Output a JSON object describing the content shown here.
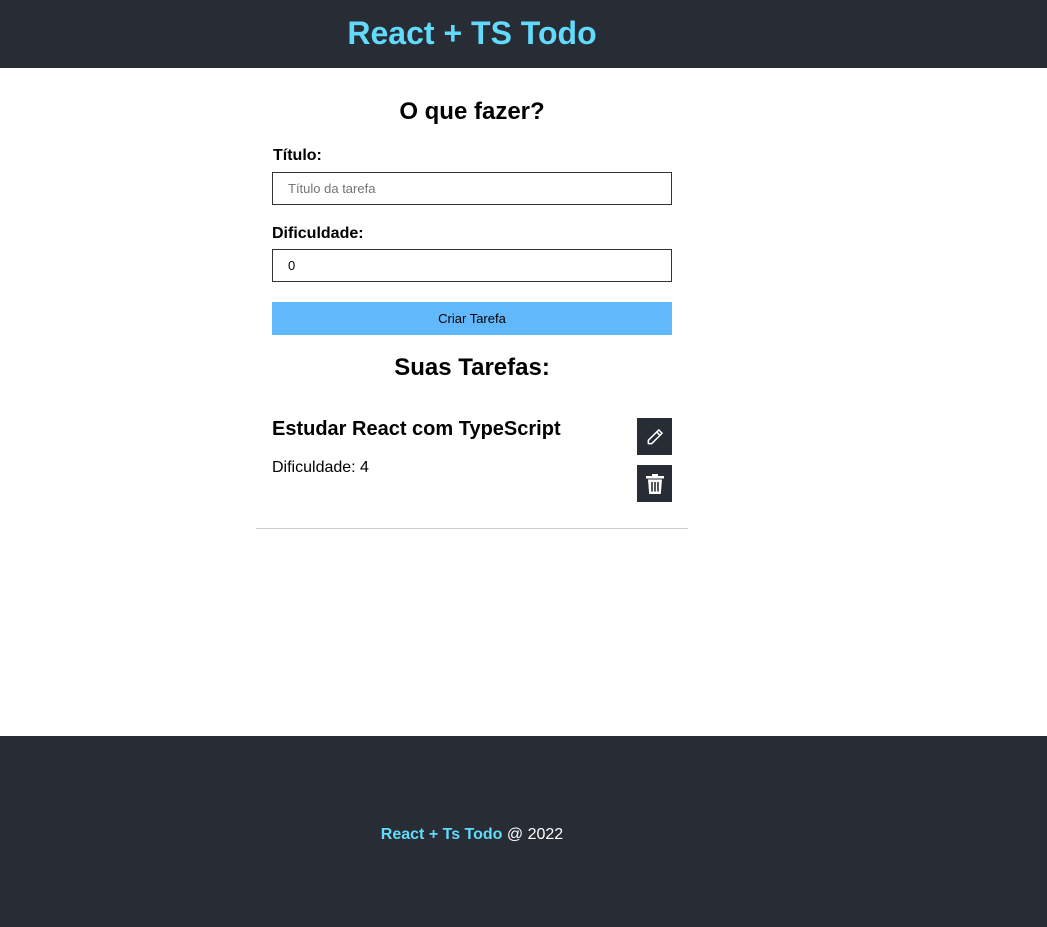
{
  "header": {
    "title": "React + TS Todo"
  },
  "form": {
    "heading": "O que fazer?",
    "title_label": "Título:",
    "title_placeholder": "Título da tarefa",
    "difficulty_label": "Dificuldade:",
    "difficulty_value": "0",
    "submit_label": "Criar Tarefa"
  },
  "tasks": {
    "heading": "Suas Tarefas:",
    "items": [
      {
        "title": "Estudar React com TypeScript",
        "difficulty": "Dificuldade: 4",
        "edit_icon": "pencil-icon",
        "delete_icon": "trash-icon"
      }
    ]
  },
  "footer": {
    "brand": "React + Ts Todo",
    "suffix": " @ 2022"
  },
  "colors": {
    "dark": "#282c34",
    "accent": "#61dafb",
    "button": "#61b8fb"
  }
}
